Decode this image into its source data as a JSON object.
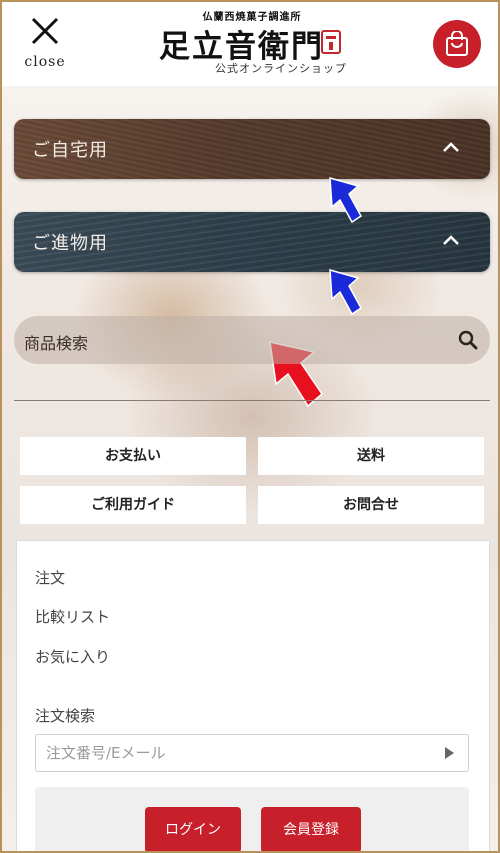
{
  "header": {
    "close_label": "close",
    "logo_subtitle": "仏蘭西焼菓子調進所",
    "logo_name": "足立音衛門",
    "logo_tagline": "公式オンラインショップ"
  },
  "categories": [
    {
      "label": "ご自宅用"
    },
    {
      "label": "ご進物用"
    }
  ],
  "search": {
    "label": "商品検索"
  },
  "info_buttons": [
    {
      "label": "お支払い"
    },
    {
      "label": "送料"
    },
    {
      "label": "ご利用ガイド"
    },
    {
      "label": "お問合せ"
    }
  ],
  "account_links": [
    {
      "label": "注文"
    },
    {
      "label": "比較リスト"
    },
    {
      "label": "お気に入り"
    }
  ],
  "order_search": {
    "heading": "注文検索",
    "placeholder": "注文番号/Eメール"
  },
  "auth": {
    "login_label": "ログイン",
    "register_label": "会員登録"
  },
  "colors": {
    "brand_red": "#c8202a",
    "home_bar": "#553a2b",
    "gift_bar": "#2e3f4b",
    "annotation_blue": "#1a2ad8",
    "annotation_red": "#e8101e"
  }
}
